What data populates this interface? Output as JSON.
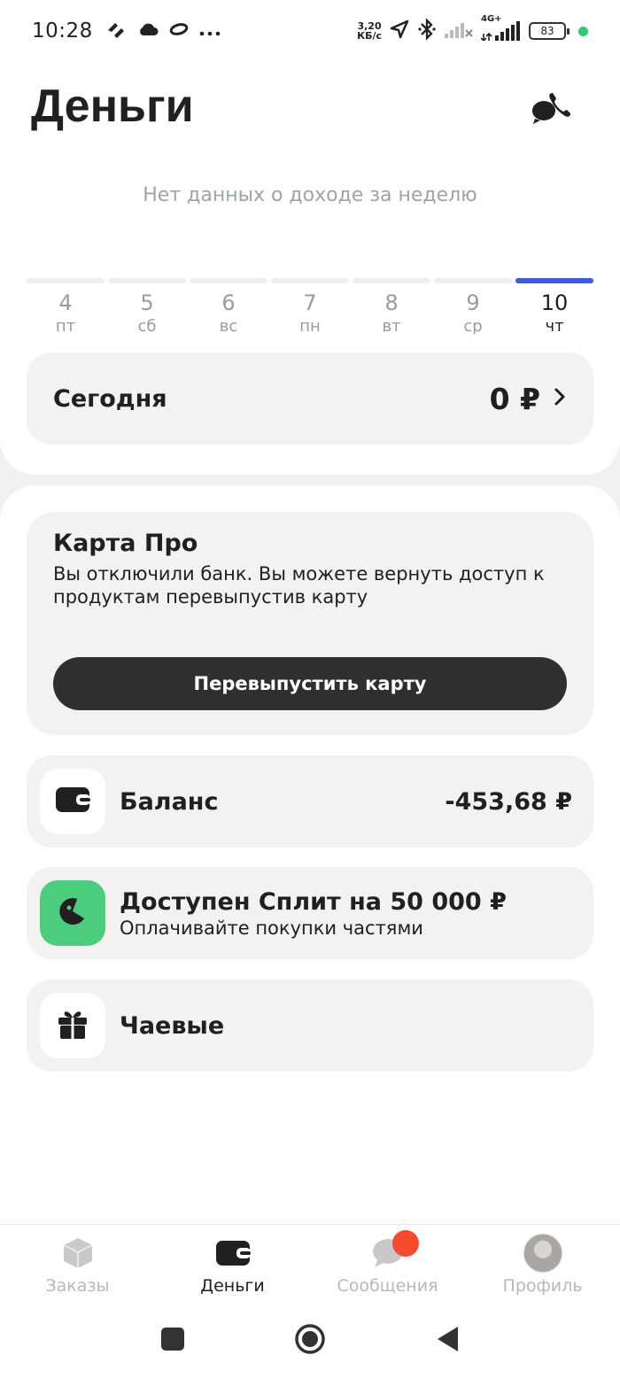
{
  "status_bar": {
    "time": "10:28",
    "speed_value": "3,20",
    "speed_unit": "КБ/с",
    "network": "4G+",
    "battery": "83",
    "icons": [
      "link-icon",
      "cloud-icon",
      "ring-icon",
      "more-icon",
      "location-arrow-icon",
      "bluetooth-icon",
      "signal-icon",
      "signal-4g-icon"
    ]
  },
  "header": {
    "title": "Деньги",
    "support_icon": "chat-phone-icon"
  },
  "income": {
    "empty_text": "Нет данных о доходе за неделю",
    "days": [
      {
        "num": "4",
        "weekday": "пт",
        "active": false
      },
      {
        "num": "5",
        "weekday": "сб",
        "active": false
      },
      {
        "num": "6",
        "weekday": "вс",
        "active": false
      },
      {
        "num": "7",
        "weekday": "пн",
        "active": false
      },
      {
        "num": "8",
        "weekday": "вт",
        "active": false
      },
      {
        "num": "9",
        "weekday": "ср",
        "active": false
      },
      {
        "num": "10",
        "weekday": "чт",
        "active": true
      }
    ],
    "today_label": "Сегодня",
    "today_value": "0 ₽"
  },
  "card_pro": {
    "title": "Карта Про",
    "text": "Вы отключили банк. Вы можете вернуть доступ к продуктам перевыпустив карту",
    "button_label": "Перевыпустить карту"
  },
  "rows": {
    "balance": {
      "title": "Баланс",
      "value": "-453,68 ₽",
      "icon": "wallet-icon"
    },
    "split": {
      "title": "Доступен Сплит на 50 000 ₽",
      "subtitle": "Оплачивайте покупки частями",
      "icon": "split-icon",
      "icon_bg": "#4ccc7d"
    },
    "tips": {
      "title": "Чаевые",
      "icon": "gift-icon"
    }
  },
  "bottom_nav": {
    "orders": "Заказы",
    "money": "Деньги",
    "messages": "Сообщения",
    "profile": "Профиль",
    "active": "money"
  },
  "colors": {
    "accent_blue": "#3b5fd9",
    "badge_red": "#f64a2f",
    "button_dark": "#302f2d"
  }
}
